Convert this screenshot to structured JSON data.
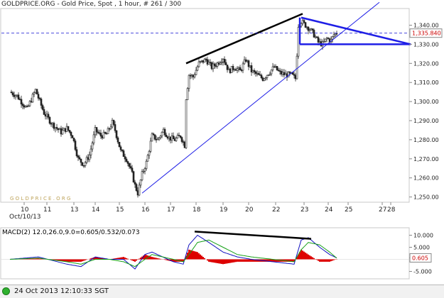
{
  "header": {
    "title": "GOLDPRICE.ORG - Gold Price, Spot , 1 hour, # 261 / 300"
  },
  "watermark": "G O L D P R I C E . O R G",
  "status_bar": {
    "timestamp": "24 Oct 2013 12:10:33 SGT"
  },
  "colors": {
    "up_candle": "#ffffff",
    "down_candle": "#222222",
    "trendline": "#1e1ee6",
    "drawing_black": "#000000",
    "current_price_line": "#2f2fd9",
    "current_price_label": "#cc0000",
    "macd_line": "#1010c0",
    "signal_line": "#16a016",
    "histogram": "#dd0000"
  },
  "chart_data": [
    {
      "type": "candlestick",
      "ylim": [
        1248,
        1348
      ],
      "y_ticks": [
        "1,340.00",
        "1,330.00",
        "1,320.00",
        "1,310.00",
        "1,300.00",
        "1,290.00",
        "1,280.00",
        "1,270.00",
        "1,260.00",
        "1,250.00"
      ],
      "x_tick_labels": [
        "10",
        "11",
        "13",
        "14",
        "15",
        "16",
        "17",
        "18",
        "19",
        "20",
        "22",
        "23",
        "24",
        "25",
        "27",
        "28"
      ],
      "x_start_label": "Oct/10/13",
      "current_price": 1335.84,
      "current_price_label": "1,335.840",
      "close_path": [
        [
          0,
          1305
        ],
        [
          5,
          1303
        ],
        [
          12,
          1296
        ],
        [
          18,
          1306
        ],
        [
          24,
          1294
        ],
        [
          30,
          1288
        ],
        [
          36,
          1284
        ],
        [
          40,
          1286
        ],
        [
          44,
          1282
        ],
        [
          48,
          1270
        ],
        [
          52,
          1267
        ],
        [
          56,
          1272
        ],
        [
          60,
          1285
        ],
        [
          64,
          1282
        ],
        [
          68,
          1283
        ],
        [
          72,
          1289
        ],
        [
          74,
          1285
        ],
        [
          78,
          1274
        ],
        [
          82,
          1270
        ],
        [
          86,
          1262
        ],
        [
          88,
          1256
        ],
        [
          90,
          1252
        ],
        [
          93,
          1262
        ],
        [
          96,
          1268
        ],
        [
          100,
          1282
        ],
        [
          104,
          1280
        ],
        [
          108,
          1285
        ],
        [
          112,
          1281
        ],
        [
          116,
          1280
        ],
        [
          120,
          1282
        ],
        [
          123,
          1277
        ],
        [
          124,
          1302
        ],
        [
          126,
          1314
        ],
        [
          129,
          1313
        ],
        [
          133,
          1320
        ],
        [
          138,
          1322
        ],
        [
          142,
          1318
        ],
        [
          146,
          1320
        ],
        [
          150,
          1323
        ],
        [
          154,
          1316
        ],
        [
          158,
          1318
        ],
        [
          162,
          1316
        ],
        [
          166,
          1322
        ],
        [
          170,
          1316
        ],
        [
          174,
          1314
        ],
        [
          178,
          1312
        ],
        [
          182,
          1315
        ],
        [
          186,
          1318
        ],
        [
          190,
          1315
        ],
        [
          194,
          1314
        ],
        [
          198,
          1314
        ],
        [
          201,
          1312
        ],
        [
          202,
          1325
        ],
        [
          203,
          1340
        ],
        [
          205,
          1342
        ],
        [
          208,
          1340
        ],
        [
          211,
          1338
        ],
        [
          214,
          1335
        ],
        [
          217,
          1331
        ],
        [
          220,
          1330
        ],
        [
          223,
          1333
        ],
        [
          226,
          1332
        ],
        [
          228,
          1335
        ],
        [
          230,
          1336
        ]
      ]
    },
    {
      "type": "line",
      "title": "MACD(2) 12.0,26.0,9.0=0.605/0.532/0.073",
      "ylim": [
        -7.5,
        12.5
      ],
      "y_ticks": [
        "10.000",
        "5.000",
        "0.605",
        "-5.000"
      ],
      "current_value": 0.605,
      "series": [
        {
          "name": "MACD",
          "values": [
            [
              0,
              0
            ],
            [
              20,
              1
            ],
            [
              40,
              -2
            ],
            [
              50,
              -3
            ],
            [
              60,
              1
            ],
            [
              70,
              0
            ],
            [
              80,
              0
            ],
            [
              88,
              -4
            ],
            [
              95,
              2
            ],
            [
              100,
              3
            ],
            [
              115,
              -1
            ],
            [
              122,
              -2
            ],
            [
              126,
              6
            ],
            [
              132,
              10
            ],
            [
              140,
              7
            ],
            [
              150,
              3
            ],
            [
              160,
              1
            ],
            [
              170,
              0
            ],
            [
              185,
              -1
            ],
            [
              200,
              -2
            ],
            [
              205,
              8
            ],
            [
              210,
              9
            ],
            [
              218,
              5
            ],
            [
              225,
              2
            ],
            [
              230,
              0.6
            ]
          ]
        },
        {
          "name": "Signal",
          "values": [
            [
              0,
              0
            ],
            [
              20,
              0.5
            ],
            [
              40,
              -1
            ],
            [
              50,
              -2
            ],
            [
              60,
              0
            ],
            [
              70,
              0
            ],
            [
              80,
              -1
            ],
            [
              88,
              -3
            ],
            [
              95,
              0
            ],
            [
              100,
              2
            ],
            [
              115,
              0
            ],
            [
              122,
              -1
            ],
            [
              126,
              2
            ],
            [
              132,
              7
            ],
            [
              140,
              8
            ],
            [
              150,
              5
            ],
            [
              160,
              2
            ],
            [
              170,
              1
            ],
            [
              185,
              0
            ],
            [
              200,
              -1
            ],
            [
              205,
              4
            ],
            [
              210,
              7
            ],
            [
              218,
              6
            ],
            [
              225,
              3
            ],
            [
              230,
              0.5
            ]
          ]
        }
      ]
    }
  ]
}
